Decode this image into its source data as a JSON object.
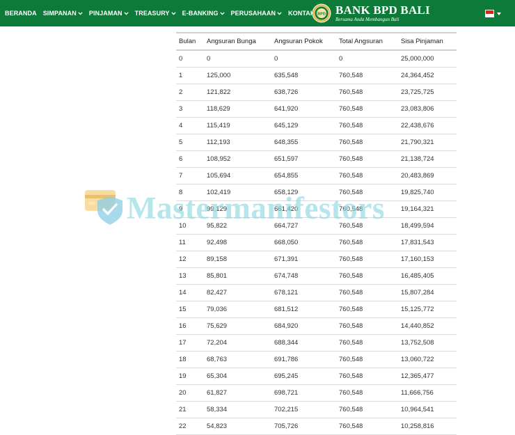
{
  "nav": {
    "items": [
      {
        "label": "BERANDA",
        "dropdown": false
      },
      {
        "label": "SIMPANAN",
        "dropdown": true
      },
      {
        "label": "PINJAMAN",
        "dropdown": true
      },
      {
        "label": "TREASURY",
        "dropdown": true
      },
      {
        "label": "E-BANKING",
        "dropdown": true
      },
      {
        "label": "PERUSAHAAN",
        "dropdown": true
      },
      {
        "label": "KONTAK",
        "dropdown": true
      }
    ],
    "brand_name": "BANK BPD BALI",
    "brand_tagline": "Bersama Anda Membangun Bali",
    "logo_text": "BPD",
    "language_flag": "indonesia-flag-icon",
    "colors": {
      "nav_bg": "#0e7a3a",
      "text": "#ffffff"
    }
  },
  "table": {
    "headers": [
      "Bulan",
      "Angsuran Bunga",
      "Angsuran Pokok",
      "Total Angsuran",
      "Sisa Pinjaman"
    ],
    "rows": [
      [
        "0",
        "0",
        "0",
        "0",
        "25,000,000"
      ],
      [
        "1",
        "125,000",
        "635,548",
        "760,548",
        "24,364,452"
      ],
      [
        "2",
        "121,822",
        "638,726",
        "760,548",
        "23,725,725"
      ],
      [
        "3",
        "118,629",
        "641,920",
        "760,548",
        "23,083,806"
      ],
      [
        "4",
        "115,419",
        "645,129",
        "760,548",
        "22,438,676"
      ],
      [
        "5",
        "112,193",
        "648,355",
        "760,548",
        "21,790,321"
      ],
      [
        "6",
        "108,952",
        "651,597",
        "760,548",
        "21,138,724"
      ],
      [
        "7",
        "105,694",
        "654,855",
        "760,548",
        "20,483,869"
      ],
      [
        "8",
        "102,419",
        "658,129",
        "760,548",
        "19,825,740"
      ],
      [
        "9",
        "99,129",
        "661,420",
        "760,548",
        "19,164,321"
      ],
      [
        "10",
        "95,822",
        "664,727",
        "760,548",
        "18,499,594"
      ],
      [
        "11",
        "92,498",
        "668,050",
        "760,548",
        "17,831,543"
      ],
      [
        "12",
        "89,158",
        "671,391",
        "760,548",
        "17,160,153"
      ],
      [
        "13",
        "85,801",
        "674,748",
        "760,548",
        "16,485,405"
      ],
      [
        "14",
        "82,427",
        "678,121",
        "760,548",
        "15,807,284"
      ],
      [
        "15",
        "79,036",
        "681,512",
        "760,548",
        "15,125,772"
      ],
      [
        "16",
        "75,629",
        "684,920",
        "760,548",
        "14,440,852"
      ],
      [
        "17",
        "72,204",
        "688,344",
        "760,548",
        "13,752,508"
      ],
      [
        "18",
        "68,763",
        "691,786",
        "760,548",
        "13,060,722"
      ],
      [
        "19",
        "65,304",
        "695,245",
        "760,548",
        "12,365,477"
      ],
      [
        "20",
        "61,827",
        "698,721",
        "760,548",
        "11,666,756"
      ],
      [
        "21",
        "58,334",
        "702,215",
        "760,548",
        "10,964,541"
      ],
      [
        "22",
        "54,823",
        "705,726",
        "760,548",
        "10,258,816"
      ]
    ]
  },
  "watermark": {
    "text": "Mastermanifestors",
    "icon": "card-shield-icon"
  }
}
